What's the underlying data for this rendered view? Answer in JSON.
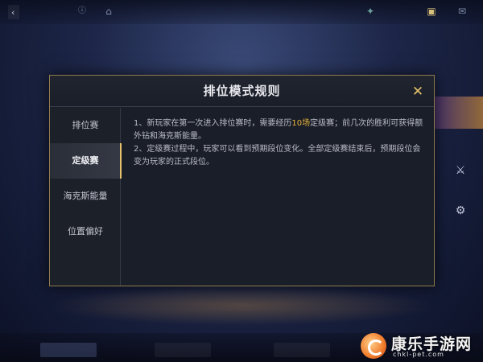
{
  "modal": {
    "title": "排位模式规则",
    "close_label": "✕"
  },
  "sidebar": {
    "items": [
      {
        "label": "排位赛",
        "active": false
      },
      {
        "label": "定级赛",
        "active": true
      },
      {
        "label": "海克斯能量",
        "active": false
      },
      {
        "label": "位置偏好",
        "active": false
      }
    ]
  },
  "content": {
    "rule1_before": "1、新玩家在第一次进入排位赛时，需要经历",
    "rule1_highlight": "10场",
    "rule1_after": "定级赛；前几次的胜利可获得额外钻和海克斯能量。",
    "rule2": "2、定级赛过程中，玩家可以看到预期段位变化。全部定级赛结束后，预期段位会变为玩家的正式段位。"
  },
  "colors": {
    "accent_gold": "#e6c26a",
    "highlight": "#e6b23c",
    "modal_bg": "#1a1e28",
    "border": "#8e7a4c"
  },
  "watermark": {
    "name": "康乐手游网",
    "url": "chkl-pet.com"
  }
}
